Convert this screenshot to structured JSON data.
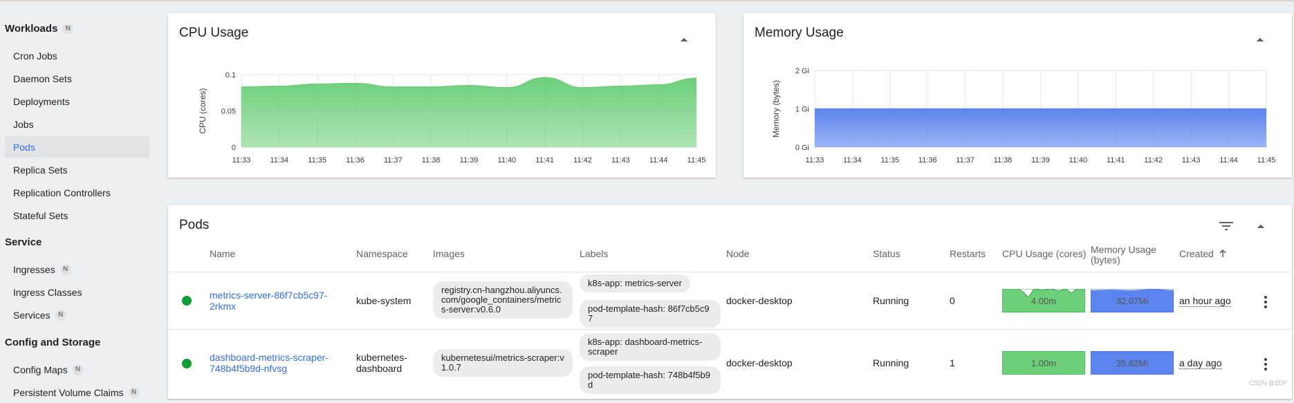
{
  "sidebar": {
    "workloads": {
      "label": "Workloads",
      "badge": "N"
    },
    "workload_items": [
      "Cron Jobs",
      "Daemon Sets",
      "Deployments",
      "Jobs",
      "Pods",
      "Replica Sets",
      "Replication Controllers",
      "Stateful Sets"
    ],
    "service": {
      "label": "Service"
    },
    "ingresses": {
      "label": "Ingresses",
      "badge": "N"
    },
    "ingress_classes": {
      "label": "Ingress Classes"
    },
    "services": {
      "label": "Services",
      "badge": "N"
    },
    "config": {
      "label": "Config and Storage"
    },
    "config_maps": {
      "label": "Config Maps",
      "badge": "N"
    },
    "pvc": {
      "label": "Persistent Volume Claims",
      "badge": "N"
    }
  },
  "cpu_card": {
    "title": "CPU Usage"
  },
  "memory_card": {
    "title": "Memory Usage"
  },
  "chart_data": [
    {
      "type": "area",
      "title": "CPU Usage",
      "ylabel": "CPU (cores)",
      "xlabel": "",
      "x": [
        "11:33",
        "11:34",
        "11:35",
        "11:36",
        "11:37",
        "11:38",
        "11:39",
        "11:40",
        "11:41",
        "11:42",
        "11:43",
        "11:44",
        "11:45"
      ],
      "y_ticks": [
        "0",
        "0.05",
        "0.1"
      ],
      "ylim": [
        0,
        0.1
      ],
      "grid": true,
      "series": [
        {
          "values": [
            0.083,
            0.084,
            0.087,
            0.088,
            0.083,
            0.083,
            0.085,
            0.082,
            0.096,
            0.082,
            0.084,
            0.086,
            0.095
          ]
        }
      ],
      "color": "#6ccf79"
    },
    {
      "type": "area",
      "title": "Memory Usage",
      "ylabel": "Memory (bytes)",
      "xlabel": "",
      "x": [
        "11:33",
        "11:34",
        "11:35",
        "11:36",
        "11:37",
        "11:38",
        "11:39",
        "11:40",
        "11:41",
        "11:42",
        "11:43",
        "11:44",
        "11:45"
      ],
      "y_ticks": [
        "0 Gi",
        "1 Gi",
        "2 Gi"
      ],
      "ylim": [
        0,
        2
      ],
      "grid": true,
      "series": [
        {
          "values": [
            1,
            1,
            1,
            1,
            1,
            1,
            1,
            1,
            1,
            1,
            1,
            1,
            1
          ]
        }
      ],
      "color": "#5b84ee"
    }
  ],
  "pods": {
    "title": "Pods",
    "columns": [
      "Name",
      "Namespace",
      "Images",
      "Labels",
      "Node",
      "Status",
      "Restarts",
      "CPU Usage (cores)",
      "Memory Usage (bytes)",
      "Created"
    ],
    "rows": [
      {
        "name": "metrics-server-86f7cb5c97-2rkmx",
        "namespace": "kube-system",
        "image": "registry.cn-hangzhou.aliyuncs.com/google_containers/metrics-server:v0.6.0",
        "labels": [
          "k8s-app: metrics-server",
          "pod-template-hash: 86f7cb5c97"
        ],
        "node": "docker-desktop",
        "status": "Running",
        "restarts": "0",
        "cpu": "4.00m",
        "memory": "32.07Mi",
        "created": "an hour ago"
      },
      {
        "name": "dashboard-metrics-scraper-748b4f5b9d-nfvsg",
        "namespace": "kubernetes-dashboard",
        "image": "kubernetesui/metrics-scraper:v1.0.7",
        "labels": [
          "k8s-app: dashboard-metrics-scraper",
          "pod-template-hash: 748b4f5b9d"
        ],
        "node": "docker-desktop",
        "status": "Running",
        "restarts": "1",
        "cpu": "1.00m",
        "memory": "35.62Mi",
        "created": "a day ago"
      }
    ]
  },
  "watermark": "CSDN @ZDP"
}
